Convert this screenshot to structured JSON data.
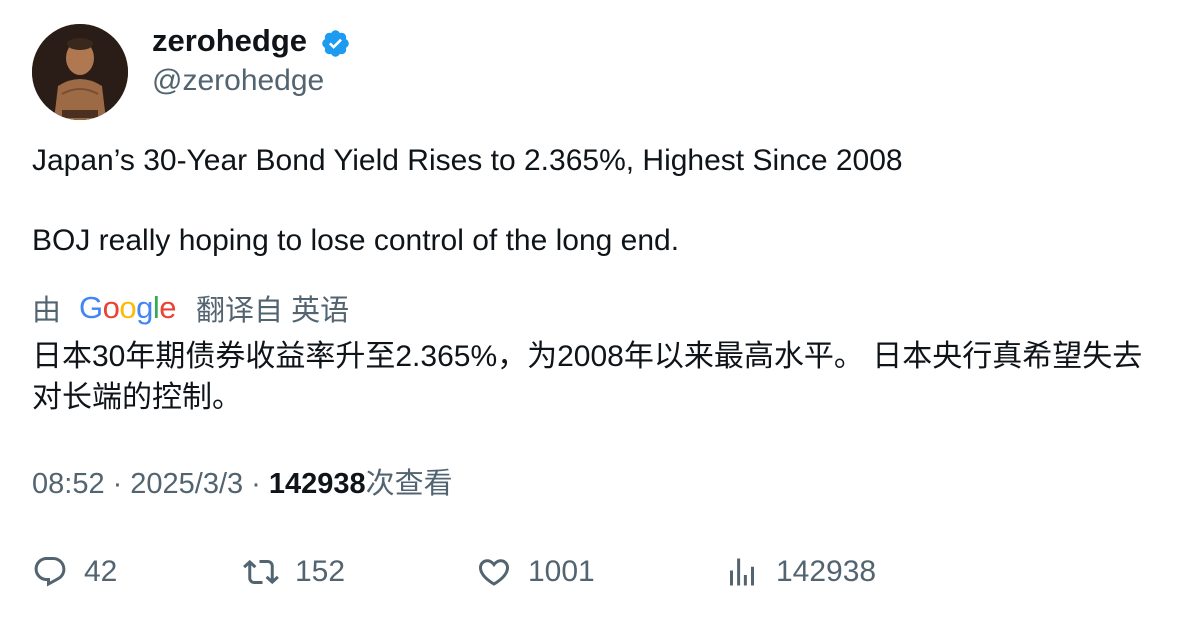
{
  "author": {
    "display_name": "zerohedge",
    "handle": "@zerohedge",
    "verified": true,
    "verified_color": "#1d9bf0"
  },
  "tweet": {
    "line1": "Japan’s 30-Year Bond Yield Rises to 2.365%, Highest Since 2008",
    "line2": "BOJ really hoping to lose control of the long end."
  },
  "translation": {
    "by_label": "由",
    "provider": "Google",
    "from_label": "翻译自 英语",
    "text": "日本30年期债券收益率升至2.365%，为2008年以来最高水平。 日本央行真希望失去对长端的控制。"
  },
  "meta": {
    "time": "08:52",
    "separator": "·",
    "date": "2025/3/3",
    "views_count": "142938",
    "views_label": "次查看"
  },
  "actions": {
    "replies": "42",
    "retweets": "152",
    "likes": "1001",
    "views": "142938"
  },
  "icons": {
    "reply": "reply-icon",
    "retweet": "retweet-icon",
    "like": "heart-icon",
    "views": "analytics-icon",
    "verified": "verified-badge-icon"
  },
  "colors": {
    "text_primary": "#0f1419",
    "text_secondary": "#536471",
    "accent": "#1d9bf0"
  }
}
